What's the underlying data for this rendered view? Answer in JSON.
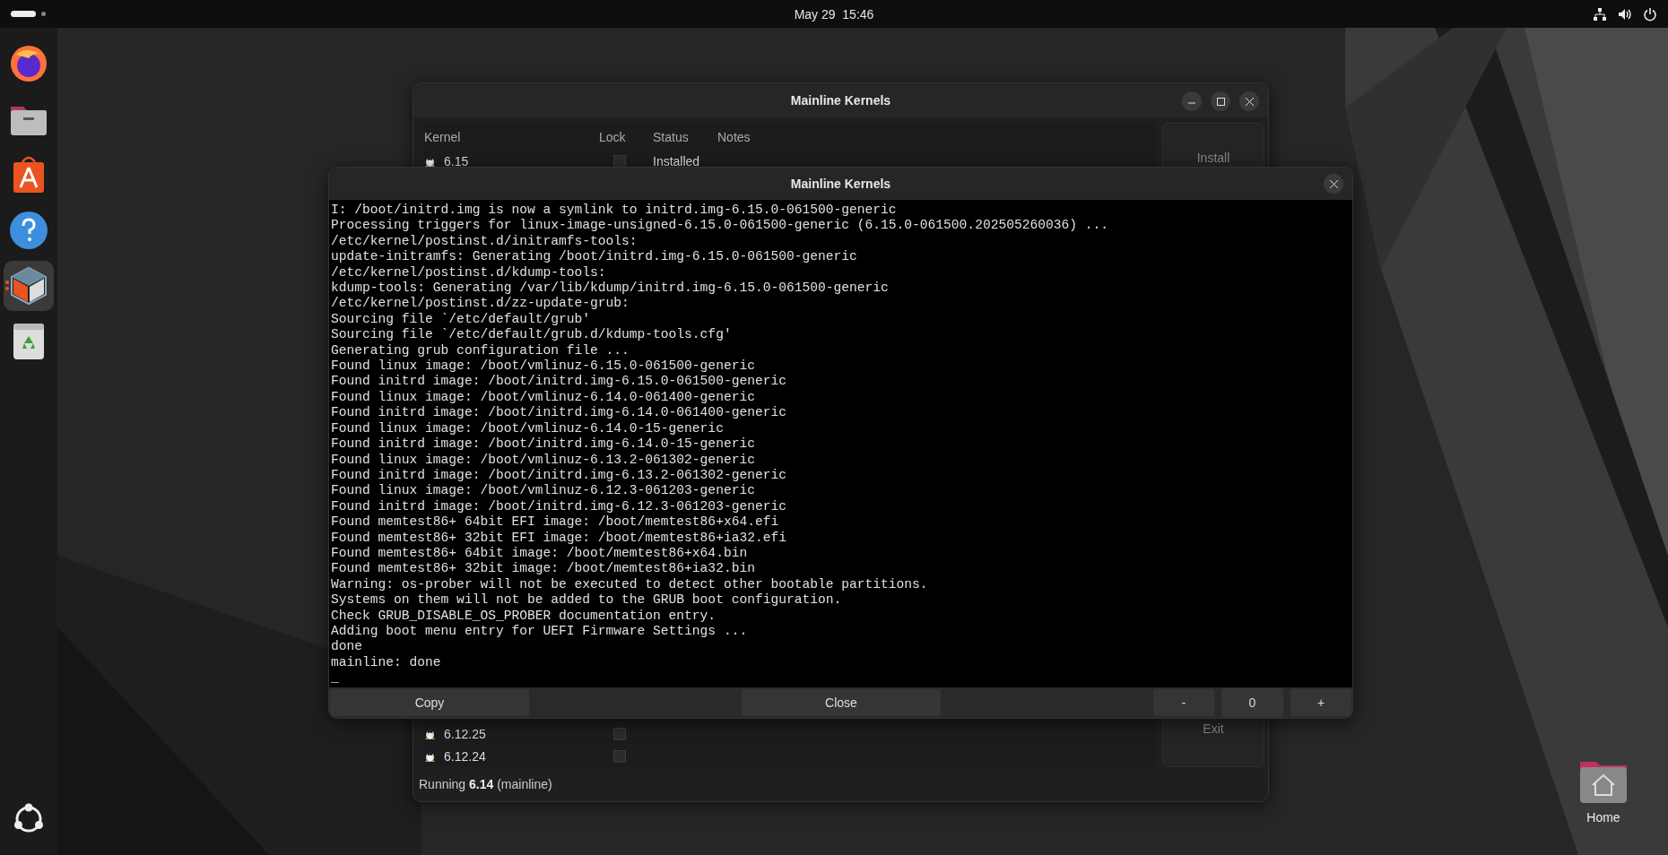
{
  "top_bar": {
    "clock": "May 29  15:46"
  },
  "dock": {
    "apps": [
      {
        "kind": "firefox",
        "active": false
      },
      {
        "kind": "files",
        "active": false
      },
      {
        "kind": "store",
        "active": false
      },
      {
        "kind": "help",
        "active": false
      },
      {
        "kind": "mainline",
        "active": true
      },
      {
        "kind": "trash",
        "active": false
      }
    ]
  },
  "back_window": {
    "title": "Mainline Kernels",
    "columns": [
      "Kernel",
      "Lock",
      "Status",
      "Notes"
    ],
    "rows": [
      {
        "kernel": "6.15",
        "locked": false,
        "status": "Installed"
      },
      {
        "kernel": "6.12.25",
        "locked": false
      },
      {
        "kernel": "6.12.24",
        "locked": false
      }
    ],
    "buttons": [
      "Install",
      "Exit"
    ],
    "status": "Running **6.14** (mainline)"
  },
  "dialog": {
    "title": "Mainline Kernels",
    "log": [
      "I: /boot/initrd.img is now a symlink to initrd.img-6.15.0-061500-generic",
      "Processing triggers for linux-image-unsigned-6.15.0-061500-generic (6.15.0-061500.202505260036) ...",
      "/etc/kernel/postinst.d/initramfs-tools:",
      "update-initramfs: Generating /boot/initrd.img-6.15.0-061500-generic",
      "/etc/kernel/postinst.d/kdump-tools:",
      "kdump-tools: Generating /var/lib/kdump/initrd.img-6.15.0-061500-generic",
      "/etc/kernel/postinst.d/zz-update-grub:",
      "Sourcing file `/etc/default/grub'",
      "Sourcing file `/etc/default/grub.d/kdump-tools.cfg'",
      "Generating grub configuration file ...",
      "Found linux image: /boot/vmlinuz-6.15.0-061500-generic",
      "Found initrd image: /boot/initrd.img-6.15.0-061500-generic",
      "Found linux image: /boot/vmlinuz-6.14.0-061400-generic",
      "Found initrd image: /boot/initrd.img-6.14.0-061400-generic",
      "Found linux image: /boot/vmlinuz-6.14.0-15-generic",
      "Found initrd image: /boot/initrd.img-6.14.0-15-generic",
      "Found linux image: /boot/vmlinuz-6.13.2-061302-generic",
      "Found initrd image: /boot/initrd.img-6.13.2-061302-generic",
      "Found linux image: /boot/vmlinuz-6.12.3-061203-generic",
      "Found initrd image: /boot/initrd.img-6.12.3-061203-generic",
      "Found memtest86+ 64bit EFI image: /boot/memtest86+x64.efi",
      "Found memtest86+ 32bit EFI image: /boot/memtest86+ia32.efi",
      "Found memtest86+ 64bit image: /boot/memtest86+x64.bin",
      "Found memtest86+ 32bit image: /boot/memtest86+ia32.bin",
      "Warning: os-prober will not be executed to detect other bootable partitions.",
      "Systems on them will not be added to the GRUB boot configuration.",
      "Check GRUB_DISABLE_OS_PROBER documentation entry.",
      "Adding boot menu entry for UEFI Firmware Settings ...",
      "done",
      "mainline: done"
    ],
    "cursor": "_",
    "copy_button": "Copy",
    "close_button": "Close",
    "minus_button": "-",
    "value": "0",
    "plus_button": "+"
  },
  "desktop_icons": [
    {
      "label": "Home"
    }
  ]
}
